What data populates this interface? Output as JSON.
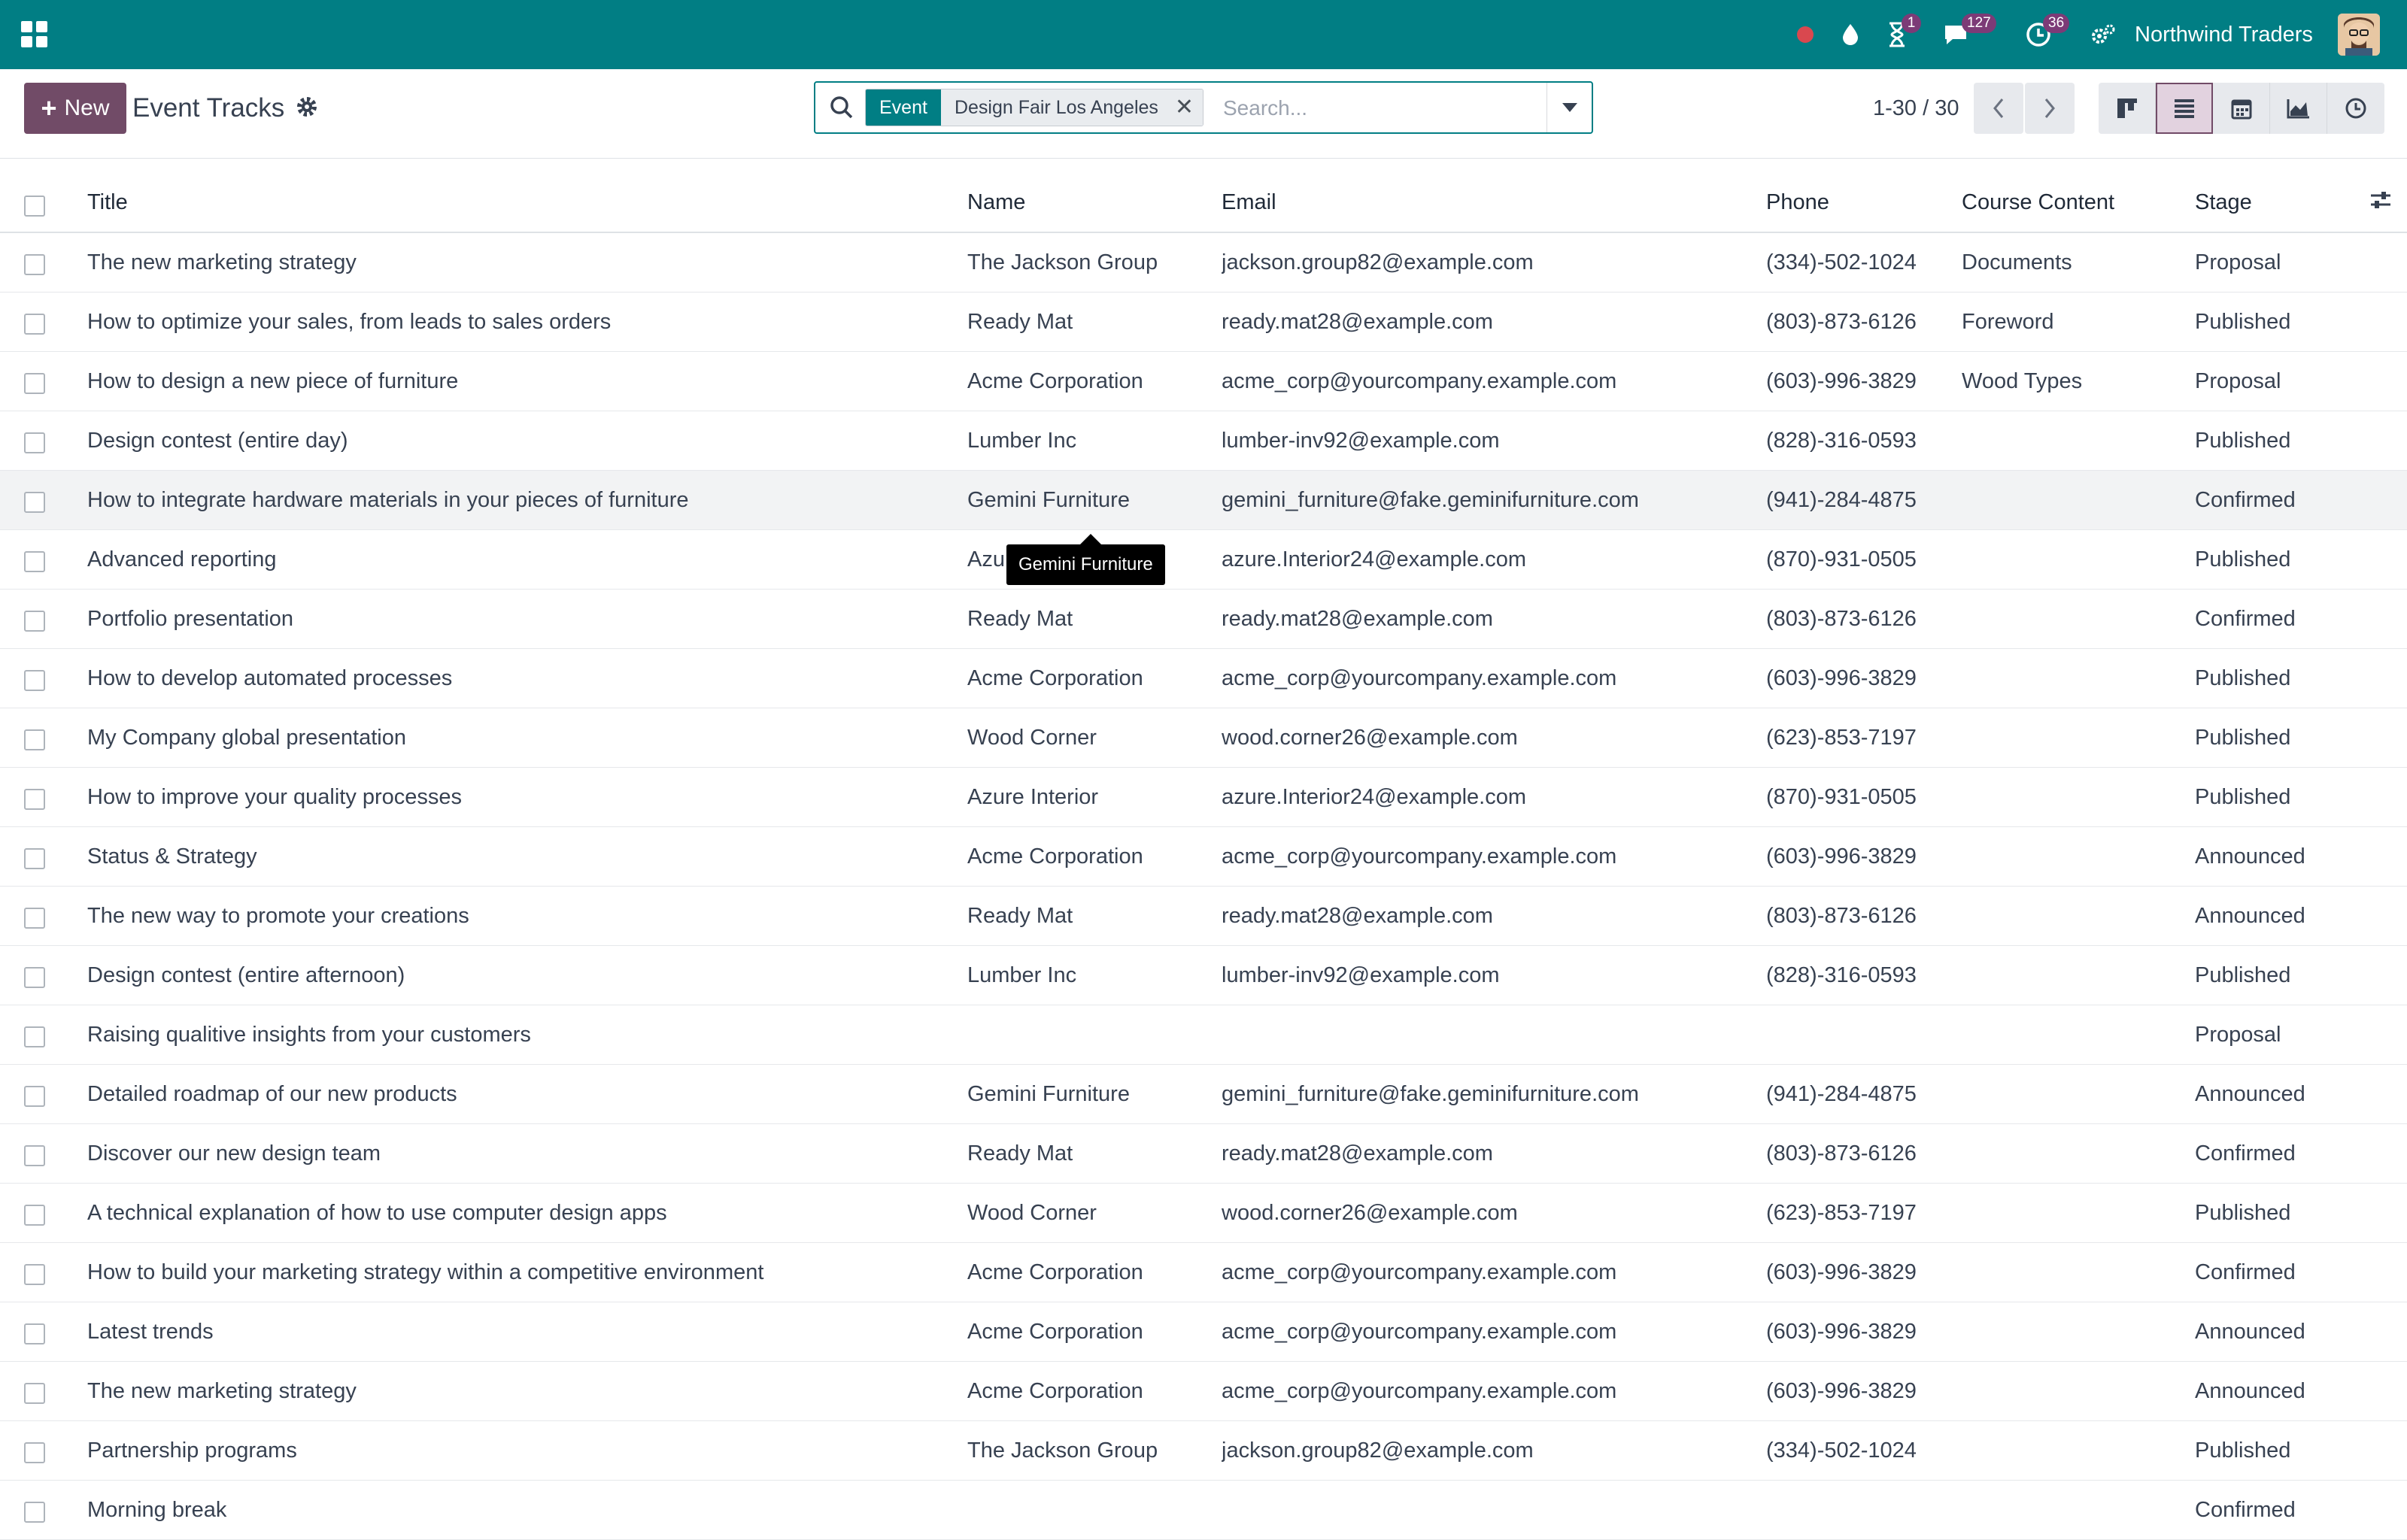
{
  "navbar": {
    "company": "Northwind Traders",
    "activity_badge": "1",
    "messages_badge": "127",
    "clock_badge": "36",
    "icons": [
      "apps-grid-icon",
      "status-dot-icon",
      "drop-icon",
      "hourglass-icon",
      "chat-icon",
      "clock-icon",
      "settings-gears-icon"
    ],
    "colors": {
      "bar": "#017e84",
      "badge": "#7c3b77",
      "status_dot": "#d9484f"
    }
  },
  "control_panel": {
    "new_label": "New",
    "title": "Event Tracks",
    "search": {
      "facet_label": "Event",
      "facet_value": "Design Fair Los Angeles",
      "placeholder": "Search..."
    },
    "pager": "1-30 / 30",
    "views": [
      "kanban",
      "list",
      "calendar",
      "graph",
      "activity"
    ],
    "active_view": "list",
    "colors": {
      "primary": "#714b67"
    }
  },
  "table": {
    "columns": [
      "Title",
      "Name",
      "Email",
      "Phone",
      "Course Content",
      "Stage"
    ],
    "rows": [
      {
        "title": "The new marketing strategy",
        "name": "The Jackson Group",
        "email": "jackson.group82@example.com",
        "phone": "(334)-502-1024",
        "course": "Documents",
        "stage": "Proposal"
      },
      {
        "title": "How to optimize your sales, from leads to sales orders",
        "name": "Ready Mat",
        "email": "ready.mat28@example.com",
        "phone": "(803)-873-6126",
        "course": "Foreword",
        "stage": "Published"
      },
      {
        "title": "How to design a new piece of furniture",
        "name": "Acme Corporation",
        "email": "acme_corp@yourcompany.example.com",
        "phone": "(603)-996-3829",
        "course": "Wood Types",
        "stage": "Proposal"
      },
      {
        "title": "Design contest (entire day)",
        "name": "Lumber Inc",
        "email": "lumber-inv92@example.com",
        "phone": "(828)-316-0593",
        "course": "",
        "stage": "Published"
      },
      {
        "title": "How to integrate hardware materials in your pieces of furniture",
        "name": "Gemini Furniture",
        "email": "gemini_furniture@fake.geminifurniture.com",
        "phone": "(941)-284-4875",
        "course": "",
        "stage": "Confirmed"
      },
      {
        "title": "Advanced reporting",
        "name": "Azure Interior",
        "email": "azure.Interior24@example.com",
        "phone": "(870)-931-0505",
        "course": "",
        "stage": "Published"
      },
      {
        "title": "Portfolio presentation",
        "name": "Ready Mat",
        "email": "ready.mat28@example.com",
        "phone": "(803)-873-6126",
        "course": "",
        "stage": "Confirmed"
      },
      {
        "title": "How to develop automated processes",
        "name": "Acme Corporation",
        "email": "acme_corp@yourcompany.example.com",
        "phone": "(603)-996-3829",
        "course": "",
        "stage": "Published"
      },
      {
        "title": "My Company global presentation",
        "name": "Wood Corner",
        "email": "wood.corner26@example.com",
        "phone": "(623)-853-7197",
        "course": "",
        "stage": "Published"
      },
      {
        "title": "How to improve your quality processes",
        "name": "Azure Interior",
        "email": "azure.Interior24@example.com",
        "phone": "(870)-931-0505",
        "course": "",
        "stage": "Published"
      },
      {
        "title": "Status & Strategy",
        "name": "Acme Corporation",
        "email": "acme_corp@yourcompany.example.com",
        "phone": "(603)-996-3829",
        "course": "",
        "stage": "Announced"
      },
      {
        "title": "The new way to promote your creations",
        "name": "Ready Mat",
        "email": "ready.mat28@example.com",
        "phone": "(803)-873-6126",
        "course": "",
        "stage": "Announced"
      },
      {
        "title": "Design contest (entire afternoon)",
        "name": "Lumber Inc",
        "email": "lumber-inv92@example.com",
        "phone": "(828)-316-0593",
        "course": "",
        "stage": "Published"
      },
      {
        "title": "Raising qualitive insights from your customers",
        "name": "",
        "email": "",
        "phone": "",
        "course": "",
        "stage": "Proposal"
      },
      {
        "title": "Detailed roadmap of our new products",
        "name": "Gemini Furniture",
        "email": "gemini_furniture@fake.geminifurniture.com",
        "phone": "(941)-284-4875",
        "course": "",
        "stage": "Announced"
      },
      {
        "title": "Discover our new design team",
        "name": "Ready Mat",
        "email": "ready.mat28@example.com",
        "phone": "(803)-873-6126",
        "course": "",
        "stage": "Confirmed"
      },
      {
        "title": "A technical explanation of how to use computer design apps",
        "name": "Wood Corner",
        "email": "wood.corner26@example.com",
        "phone": "(623)-853-7197",
        "course": "",
        "stage": "Published"
      },
      {
        "title": "How to build your marketing strategy within a competitive environment",
        "name": "Acme Corporation",
        "email": "acme_corp@yourcompany.example.com",
        "phone": "(603)-996-3829",
        "course": "",
        "stage": "Confirmed"
      },
      {
        "title": "Latest trends",
        "name": "Acme Corporation",
        "email": "acme_corp@yourcompany.example.com",
        "phone": "(603)-996-3829",
        "course": "",
        "stage": "Announced"
      },
      {
        "title": "The new marketing strategy",
        "name": "Acme Corporation",
        "email": "acme_corp@yourcompany.example.com",
        "phone": "(603)-996-3829",
        "course": "",
        "stage": "Announced"
      },
      {
        "title": "Partnership programs",
        "name": "The Jackson Group",
        "email": "jackson.group82@example.com",
        "phone": "(334)-502-1024",
        "course": "",
        "stage": "Published"
      },
      {
        "title": "Morning break",
        "name": "",
        "email": "",
        "phone": "",
        "course": "",
        "stage": "Confirmed"
      }
    ]
  },
  "tooltip": {
    "text": "Gemini Furniture"
  }
}
